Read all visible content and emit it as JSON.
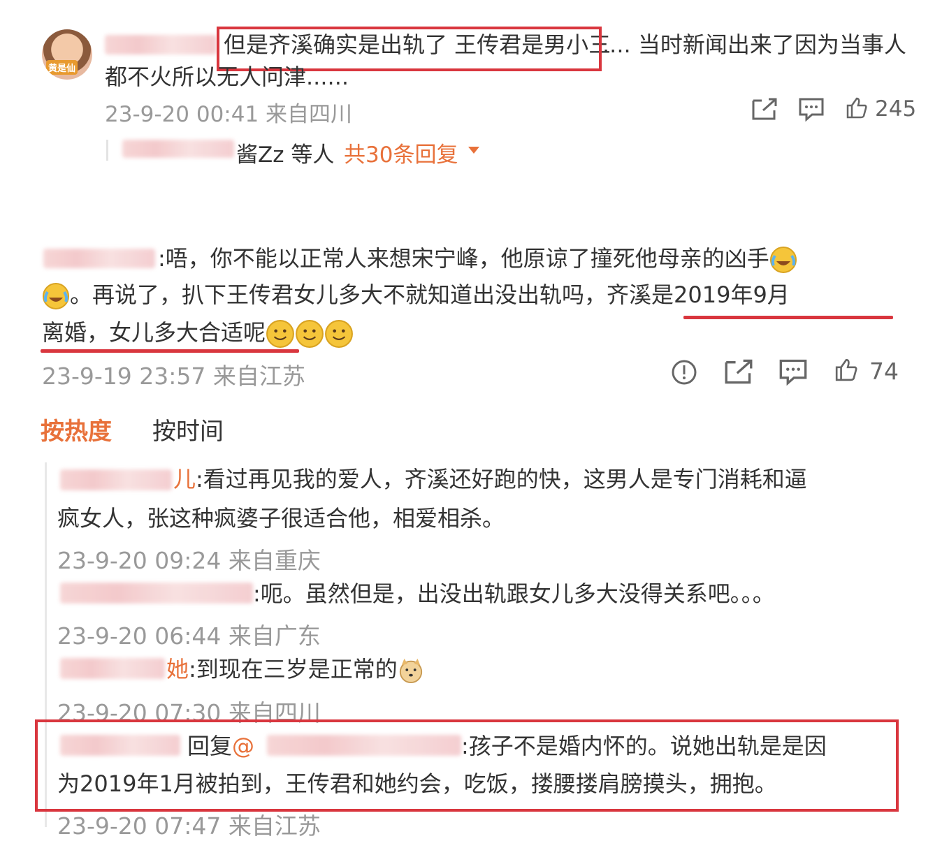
{
  "comment1": {
    "highlight": "但是齐溪确实是出轨了 王传君是男小三",
    "rest": ".... 当时新闻出来了因为当事人",
    "line2": "都不火所以无人问津......",
    "time": "23-9-20 00:41 来自四川",
    "likes": "245",
    "reply_names": "酱Zz 等人",
    "reply_count": "共30条回复"
  },
  "comment2": {
    "line1": ":唔，你不能以正常人来想宋宁峰，他原谅了撞死他母亲的凶手",
    "line2a": "。再说了，扒下王传君女儿多大不就知道出没出轨吗，",
    "line2b": "齐溪是2019年9月",
    "line3": "离婚，女儿多大合适呢",
    "time": "23-9-19 23:57 来自江苏",
    "likes": "74"
  },
  "sort": {
    "hot": "按热度",
    "time": "按时间"
  },
  "replies": [
    {
      "name_tail": "儿",
      "text1": ":看过再见我的爱人，齐溪还好跑的快，这男人是专门消耗和逼",
      "text2": "疯女人，张这种疯婆子很适合他，相爱相杀。",
      "time": "23-9-20 09:24 来自重庆"
    },
    {
      "name_tail": "",
      "text1": ":呃。虽然但是，出没出轨跟女儿多大没得关系吧。。。",
      "time": "23-9-20 06:44 来自广东"
    },
    {
      "name_tail": "她",
      "text1": ":到现在三岁是正常的",
      "time": "23-9-20 07:30 来自四川"
    },
    {
      "name_tail": "",
      "text1a": "回复@",
      "text1b": ":孩子不是婚内怀的。说她出轨是是因",
      "text2": "为2019年1月被拍到，王传君和她约会，吃饭，搂腰搂肩膀摸头，拥抱。",
      "time": "23-9-20 07:47 来自江苏"
    }
  ],
  "colors": {
    "accent": "#e8713a",
    "highlight_red": "#d9363e",
    "time_gray": "#999999"
  },
  "avatar_badge": "黄是仙"
}
